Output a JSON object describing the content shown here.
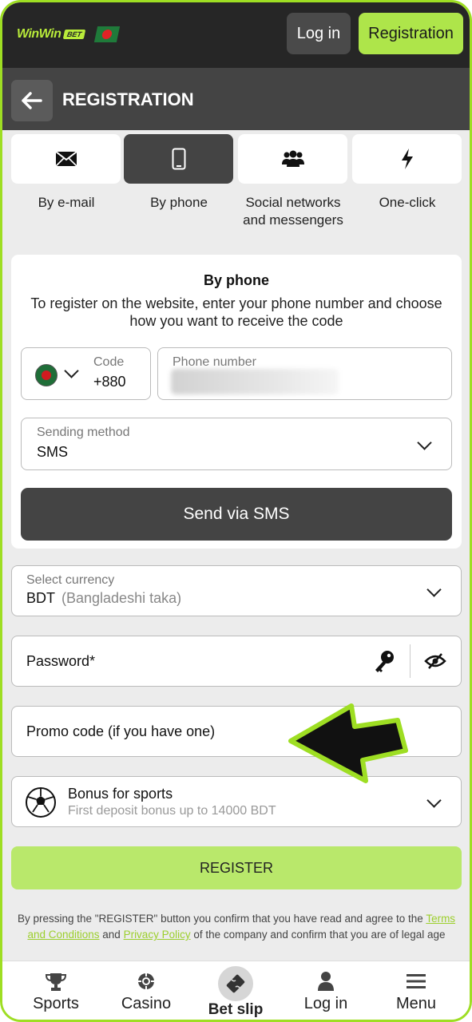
{
  "header": {
    "logo_text": "WinWin",
    "logo_badge": "BET",
    "login_label": "Log in",
    "registration_label": "Registration"
  },
  "title_bar": {
    "back_icon": "arrow-left-icon",
    "title": "REGISTRATION"
  },
  "methods": [
    {
      "label": "By e-mail",
      "icon": "envelope-icon",
      "active": false
    },
    {
      "label": "By phone",
      "icon": "smartphone-icon",
      "active": true
    },
    {
      "label_line1": "Social networks",
      "label_line2": "and messengers",
      "icon": "people-icon",
      "active": false
    },
    {
      "label": "One-click",
      "icon": "lightning-icon",
      "active": false
    }
  ],
  "phone_card": {
    "title": "By phone",
    "description": "To register on the website, enter your phone number and choose how you want to receive the code",
    "code_label": "Code",
    "code_value": "+880",
    "phone_label": "Phone number",
    "sending_label": "Sending method",
    "sending_value": "SMS",
    "send_button": "Send via SMS"
  },
  "currency": {
    "label": "Select currency",
    "code": "BDT",
    "name": "(Bangladeshi taka)"
  },
  "password": {
    "placeholder": "Password*"
  },
  "promo": {
    "placeholder": "Promo code (if you have one)"
  },
  "bonus": {
    "title": "Bonus for sports",
    "subtitle": "First deposit bonus up to 14000 BDT"
  },
  "register_button": "REGISTER",
  "legal": {
    "part1": "By pressing the \"REGISTER\" button you confirm that you have read and agree to the ",
    "terms_link": "Terms and Conditions",
    "part2": " and ",
    "privacy_link": "Privacy Policy",
    "part3": " of the company and confirm that you are of legal age"
  },
  "bottom_nav": {
    "sports": "Sports",
    "casino": "Casino",
    "betslip": "Bet slip",
    "login": "Log in",
    "menu": "Menu"
  },
  "colors": {
    "accent": "#aee54a",
    "dark": "#262626",
    "frame": "#9ede23"
  }
}
